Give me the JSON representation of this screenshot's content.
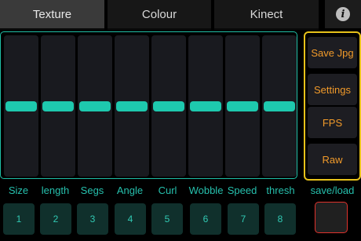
{
  "tabs": [
    {
      "label": "Texture",
      "active": true
    },
    {
      "label": "Colour",
      "active": false
    },
    {
      "label": "Kinect",
      "active": false
    }
  ],
  "info_icon": "info-icon",
  "sliders": [
    {
      "label": "Size",
      "value": 0.5
    },
    {
      "label": "length",
      "value": 0.5
    },
    {
      "label": "Segs",
      "value": 0.5
    },
    {
      "label": "Angle",
      "value": 0.5
    },
    {
      "label": "Curl",
      "value": 0.5
    },
    {
      "label": "Wobble",
      "value": 0.5
    },
    {
      "label": "Speed",
      "value": 0.5
    },
    {
      "label": "thresh",
      "value": 0.5
    }
  ],
  "side_buttons": [
    "Save Jpg",
    "Settings",
    "FPS",
    "Raw"
  ],
  "save_load_label": "save/load",
  "preset_buttons": [
    "1",
    "2",
    "3",
    "4",
    "5",
    "6",
    "7",
    "8"
  ],
  "colors": {
    "accent": "#1ec9ae",
    "panel_border": "#1fbfa6",
    "button_border": "#e7c21a",
    "button_text": "#f19a2a",
    "record_border": "#e0322c"
  }
}
